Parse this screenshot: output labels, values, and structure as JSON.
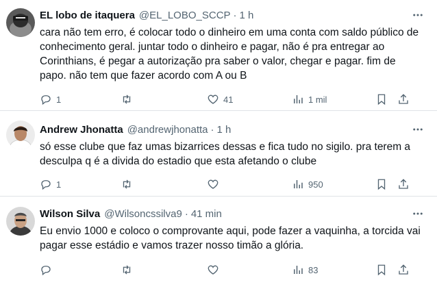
{
  "tweets": [
    {
      "name": "EL lobo de itaquera",
      "handle": "@EL_LOBO_SCCP",
      "dot": "·",
      "time": "1 h",
      "text": "cara não tem erro, é colocar todo o dinheiro em uma conta com saldo público de conhecimento geral. juntar todo o dinheiro e pagar, não é pra entregar ao Corinthians, é pegar a autorização pra saber o valor, chegar e pagar. fim de papo. não tem que fazer acordo com A ou B",
      "replies": "1",
      "retweets": "",
      "likes": "41",
      "views": "1 mil"
    },
    {
      "name": "Andrew Jhonatta",
      "handle": "@andrewjhonatta",
      "dot": "·",
      "time": "1 h",
      "text": "só esse clube que faz umas bizarrices dessas e fica tudo no sigilo. pra terem a desculpa q é a divida do estadio que esta afetando o clube",
      "replies": "1",
      "retweets": "",
      "likes": "",
      "views": "950"
    },
    {
      "name": "Wilson Silva",
      "handle": "@Wilsoncssilva9",
      "dot": "·",
      "time": "41 min",
      "text": "Eu envio 1000 e coloco o comprovante aqui, pode fazer a vaquinha, a torcida vai pagar esse estádio e vamos trazer nosso timão a glória.",
      "replies": "",
      "retweets": "",
      "likes": "",
      "views": "83"
    }
  ],
  "icons": {
    "more": "more-horizontal-icon",
    "reply": "reply-icon",
    "retweet": "retweet-icon",
    "like": "heart-icon",
    "views": "views-bar-chart-icon",
    "bookmark": "bookmark-icon",
    "share": "share-icon"
  },
  "colors": {
    "text": "#0f1419",
    "muted": "#536471",
    "border": "#dfe3e7"
  }
}
